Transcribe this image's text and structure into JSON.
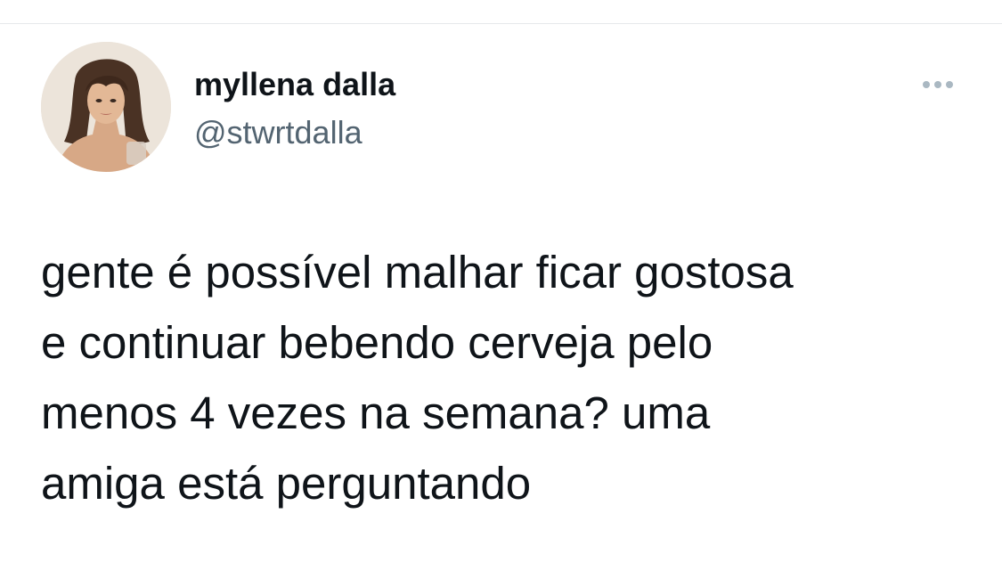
{
  "tweet": {
    "author": {
      "display_name": "myllena dalla",
      "handle": "@stwrtdalla",
      "avatar_icon": "profile-photo"
    },
    "more_icon": "more-options-icon",
    "text": "gente é possível malhar ficar gostosa\ne continuar bebendo cerveja pelo\nmenos 4 vezes na semana? uma\namiga está perguntando"
  },
  "colors": {
    "text_primary": "#0f1419",
    "text_secondary": "#536471",
    "icon_muted": "#aab8c2",
    "divider": "#e6e9eb",
    "background": "#ffffff"
  }
}
